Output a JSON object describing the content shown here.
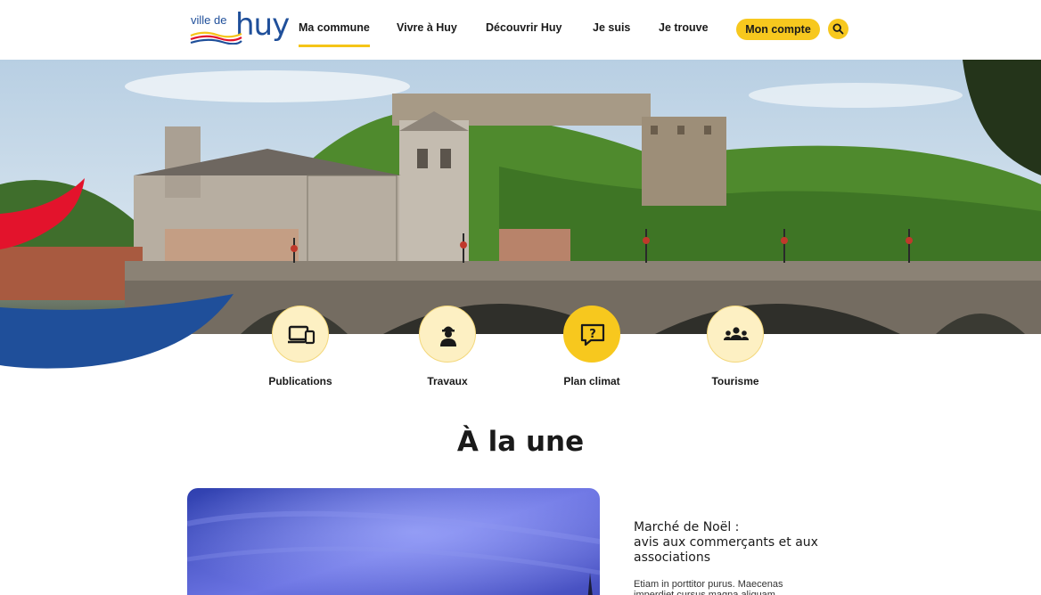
{
  "header": {
    "logo": {
      "text_small": "ville de",
      "text_large": "huy"
    },
    "nav": [
      {
        "label": "Ma commune",
        "active": true
      },
      {
        "label": "Vivre à Huy",
        "active": false
      },
      {
        "label": "Découvrir Huy",
        "active": false
      },
      {
        "label": "Je suis",
        "active": false
      },
      {
        "label": "Je trouve",
        "active": false
      }
    ],
    "account_button": "Mon compte",
    "search_icon": "search-icon"
  },
  "quick_links": [
    {
      "label": "Publications",
      "icon": "devices-icon"
    },
    {
      "label": "Travaux",
      "icon": "worker-icon"
    },
    {
      "label": "Plan climat",
      "icon": "question-bubble-icon",
      "highlight": true
    },
    {
      "label": "Tourisme",
      "icon": "group-icon"
    }
  ],
  "main": {
    "section_title": "À la une",
    "news": {
      "title_line1": "Marché de Noël :",
      "title_line2": "avis aux commerçants et aux associations",
      "excerpt": "Etiam in porttitor purus. Maecenas imperdiet cursus magna aliquam"
    }
  },
  "colors": {
    "accent_yellow": "#f7c81e",
    "brand_blue": "#1f4f9a",
    "brand_red": "#e3132c"
  }
}
